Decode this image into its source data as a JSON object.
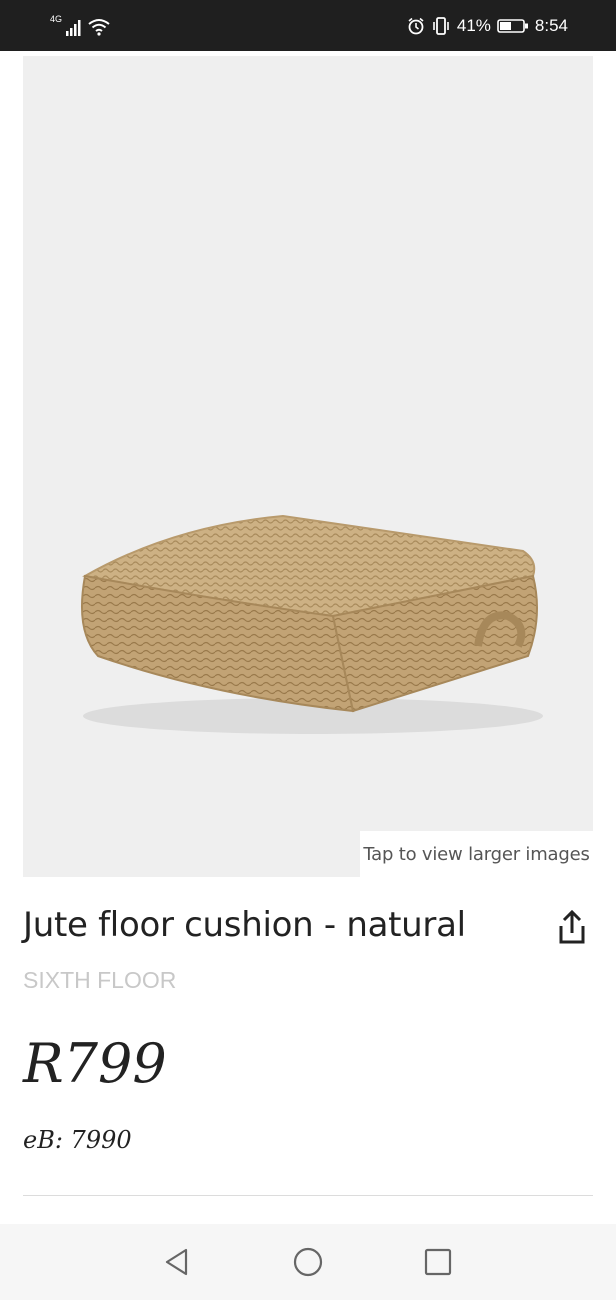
{
  "status_bar": {
    "network": "4G",
    "battery_percent": "41%",
    "time": "8:54",
    "icons": [
      "signal-icon",
      "wifi-icon",
      "alarm-icon",
      "vibrate-icon",
      "battery-icon"
    ]
  },
  "product": {
    "image_hint": "Tap to view larger images",
    "title": "Jute floor cushion - natural",
    "brand": "SIXTH FLOOR",
    "price": "R799",
    "ebucks": "eB: 7990"
  },
  "nav_bar": {
    "icons": [
      "back-icon",
      "home-icon",
      "recents-icon"
    ]
  },
  "colors": {
    "status_bar_bg": "#1f1f1f",
    "image_bg": "#efefef",
    "brand_text": "#c8c8c8",
    "nav_bg": "#f6f6f6"
  }
}
